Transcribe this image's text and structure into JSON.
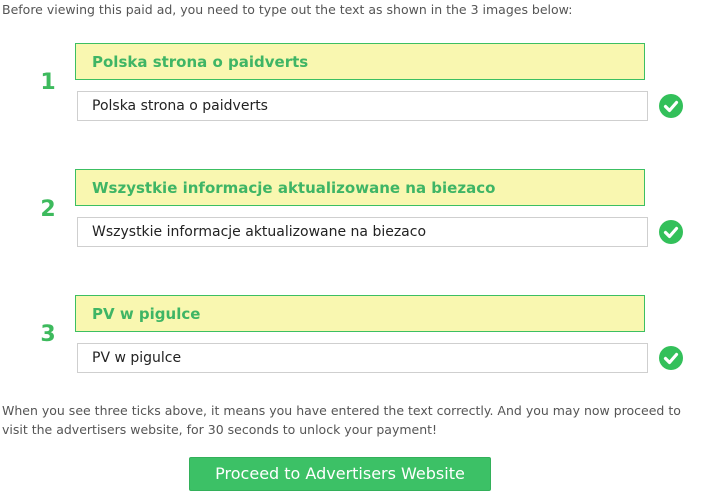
{
  "intro_text": "Before viewing this paid ad, you need to type out the text as shown in the 3 images below:",
  "captchas": [
    {
      "number": "1",
      "image_text": "Polska strona o paidverts",
      "input_value": "Polska strona o paidverts",
      "status_icon": "check-circle-icon"
    },
    {
      "number": "2",
      "image_text": "Wszystkie informacje aktualizowane na biezaco",
      "input_value": "Wszystkie informacje aktualizowane na biezaco",
      "status_icon": "check-circle-icon"
    },
    {
      "number": "3",
      "image_text": "PV w pigulce",
      "input_value": "PV w pigulce",
      "status_icon": "check-circle-icon"
    }
  ],
  "footer_text": "When you see three ticks above, it means you have entered the text correctly. And you may now proceed to visit the advertisers website, for 30 seconds to unlock your payment!",
  "proceed_button_label": "Proceed to Advertisers Website",
  "colors": {
    "accent_green": "#3cc166",
    "banner_yellow": "#f9f7b0",
    "check_green": "#33c05a"
  }
}
